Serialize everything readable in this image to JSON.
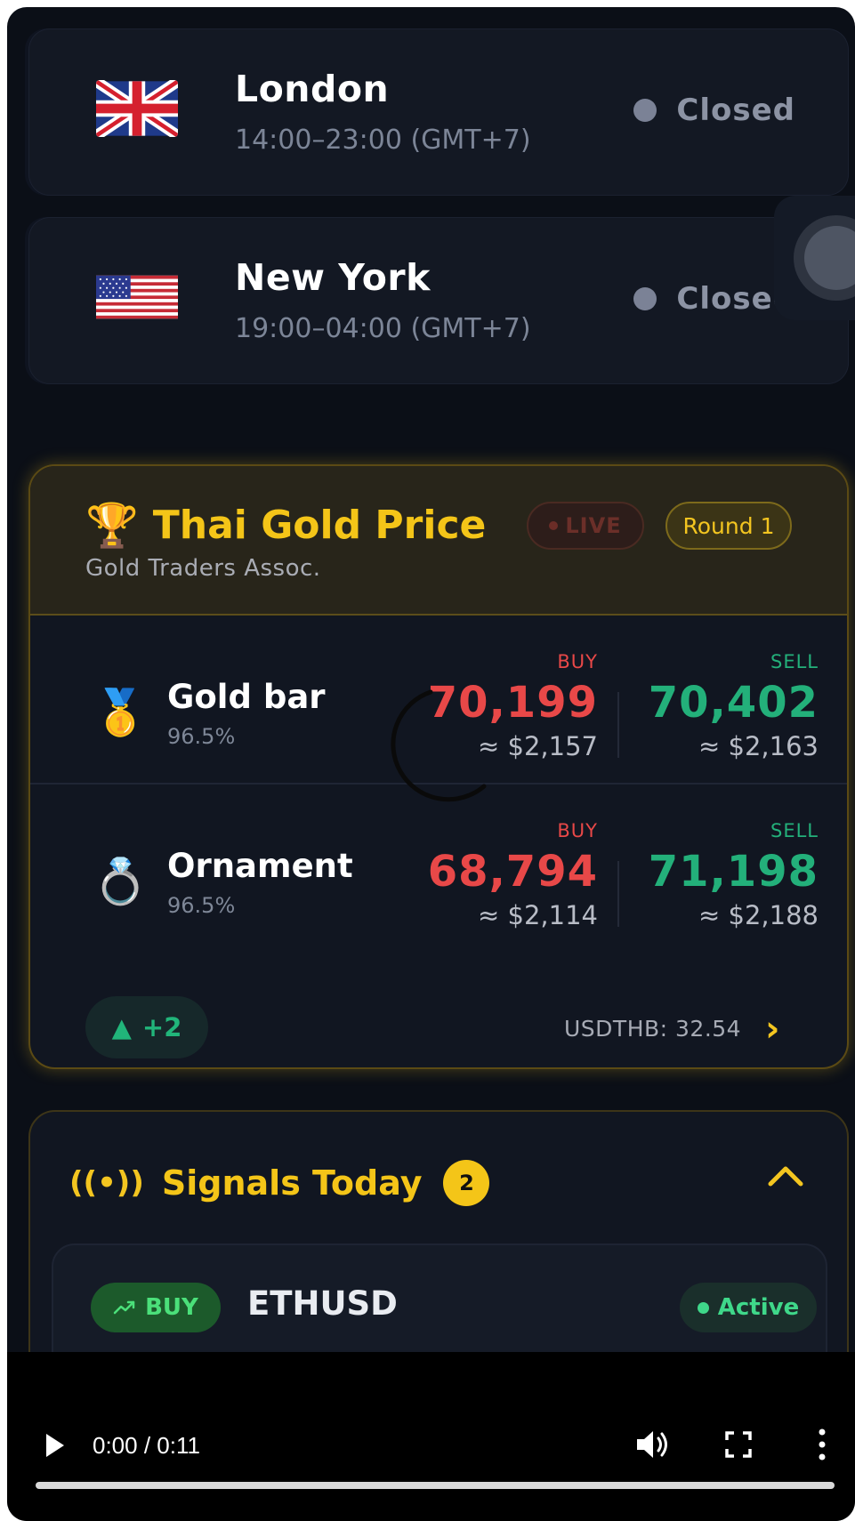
{
  "sessions": [
    {
      "city": "London",
      "hours": "14:00–23:00 (GMT+7)",
      "status": "Closed",
      "flag_icon": "uk-flag-icon"
    },
    {
      "city": "New York",
      "hours": "19:00–04:00 (GMT+7)",
      "status": "Closed",
      "flag_icon": "us-flag-icon"
    }
  ],
  "gold": {
    "title": "Thai Gold Price",
    "subtitle": "Gold Traders Assoc.",
    "live_label": "LIVE",
    "round_label": "Round 1",
    "buy_label": "BUY",
    "sell_label": "SELL",
    "items": [
      {
        "name": "Gold bar",
        "purity": "96.5%",
        "buy": "70,199",
        "buy_usd": "≈ $2,157",
        "sell": "70,402",
        "sell_usd": "≈ $2,163",
        "icon": "medal-icon"
      },
      {
        "name": "Ornament",
        "purity": "96.5%",
        "buy": "68,794",
        "buy_usd": "≈ $2,114",
        "sell": "71,198",
        "sell_usd": "≈ $2,188",
        "icon": "ring-icon"
      }
    ],
    "change": "+2",
    "usdthb": "USDTHB: 32.54",
    "colors": {
      "accent": "#f4c518",
      "buy": "#e84848",
      "sell": "#23b07a"
    }
  },
  "signals": {
    "title": "Signals Today",
    "count": "2",
    "item": {
      "side": "BUY",
      "symbol": "ETHUSD",
      "status": "Active"
    }
  },
  "video": {
    "time": "0:00 / 0:11",
    "progress": 0
  }
}
